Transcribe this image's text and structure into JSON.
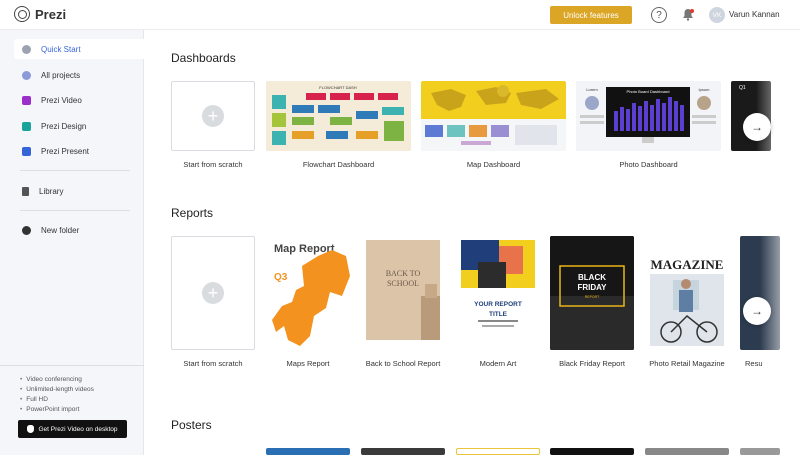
{
  "header": {
    "logo_text": "Prezi",
    "unlock_label": "Unlock features",
    "help_label": "?",
    "avatar_initials": "VK",
    "user_name": "Varun Kannan"
  },
  "sidebar": {
    "items": [
      {
        "label": "Quick Start",
        "icon": "plus-circle-icon",
        "active": true
      },
      {
        "label": "All projects",
        "icon": "globe-icon"
      },
      {
        "label": "Prezi Video",
        "icon": "video-icon"
      },
      {
        "label": "Prezi Design",
        "icon": "design-icon"
      },
      {
        "label": "Prezi Present",
        "icon": "present-icon"
      },
      {
        "label": "Library",
        "icon": "library-icon"
      },
      {
        "label": "New folder",
        "icon": "add-folder-icon"
      }
    ],
    "features": [
      "Video conferencing",
      "Unlimited-length videos",
      "Full HD",
      "PowerPoint import"
    ],
    "desktop_button": "Get Prezi Video on desktop"
  },
  "sections": [
    {
      "title": "Dashboards",
      "cards": [
        "Start from scratch",
        "Flowchart Dashboard",
        "Map Dashboard",
        "Photo Dashboard"
      ]
    },
    {
      "title": "Reports",
      "cards": [
        "Start from scratch",
        "Maps Report",
        "Back to School Report",
        "Modern Art",
        "Black Friday Report",
        "Photo Retail Magazine",
        "Resu"
      ]
    },
    {
      "title": "Posters",
      "cards": []
    }
  ],
  "thumb_text": {
    "flowchart_title": "FLOWCHART DASH",
    "photo_dash_title": "Photo Board Dashboard",
    "photo_left": "Lorem",
    "photo_right": "Ipsum",
    "next_card_text": "Q1",
    "map_report_title": "Map Report",
    "map_report_q": "Q3",
    "school_line1": "BACK TO",
    "school_line2": "SCHOOL",
    "modern_title1": "YOUR REPORT",
    "modern_title2": "TITLE",
    "bf_line1": "BLACK",
    "bf_line2": "FRIDAY",
    "bf_sub": "REPORT",
    "magazine_title": "MAGAZINE"
  },
  "colors": {
    "accent": "#dba626",
    "active_link": "#3a66d6",
    "map_yellow": "#f2cf1f",
    "maps_orange": "#f3921e",
    "purple_chart": "#5b3fd0"
  }
}
